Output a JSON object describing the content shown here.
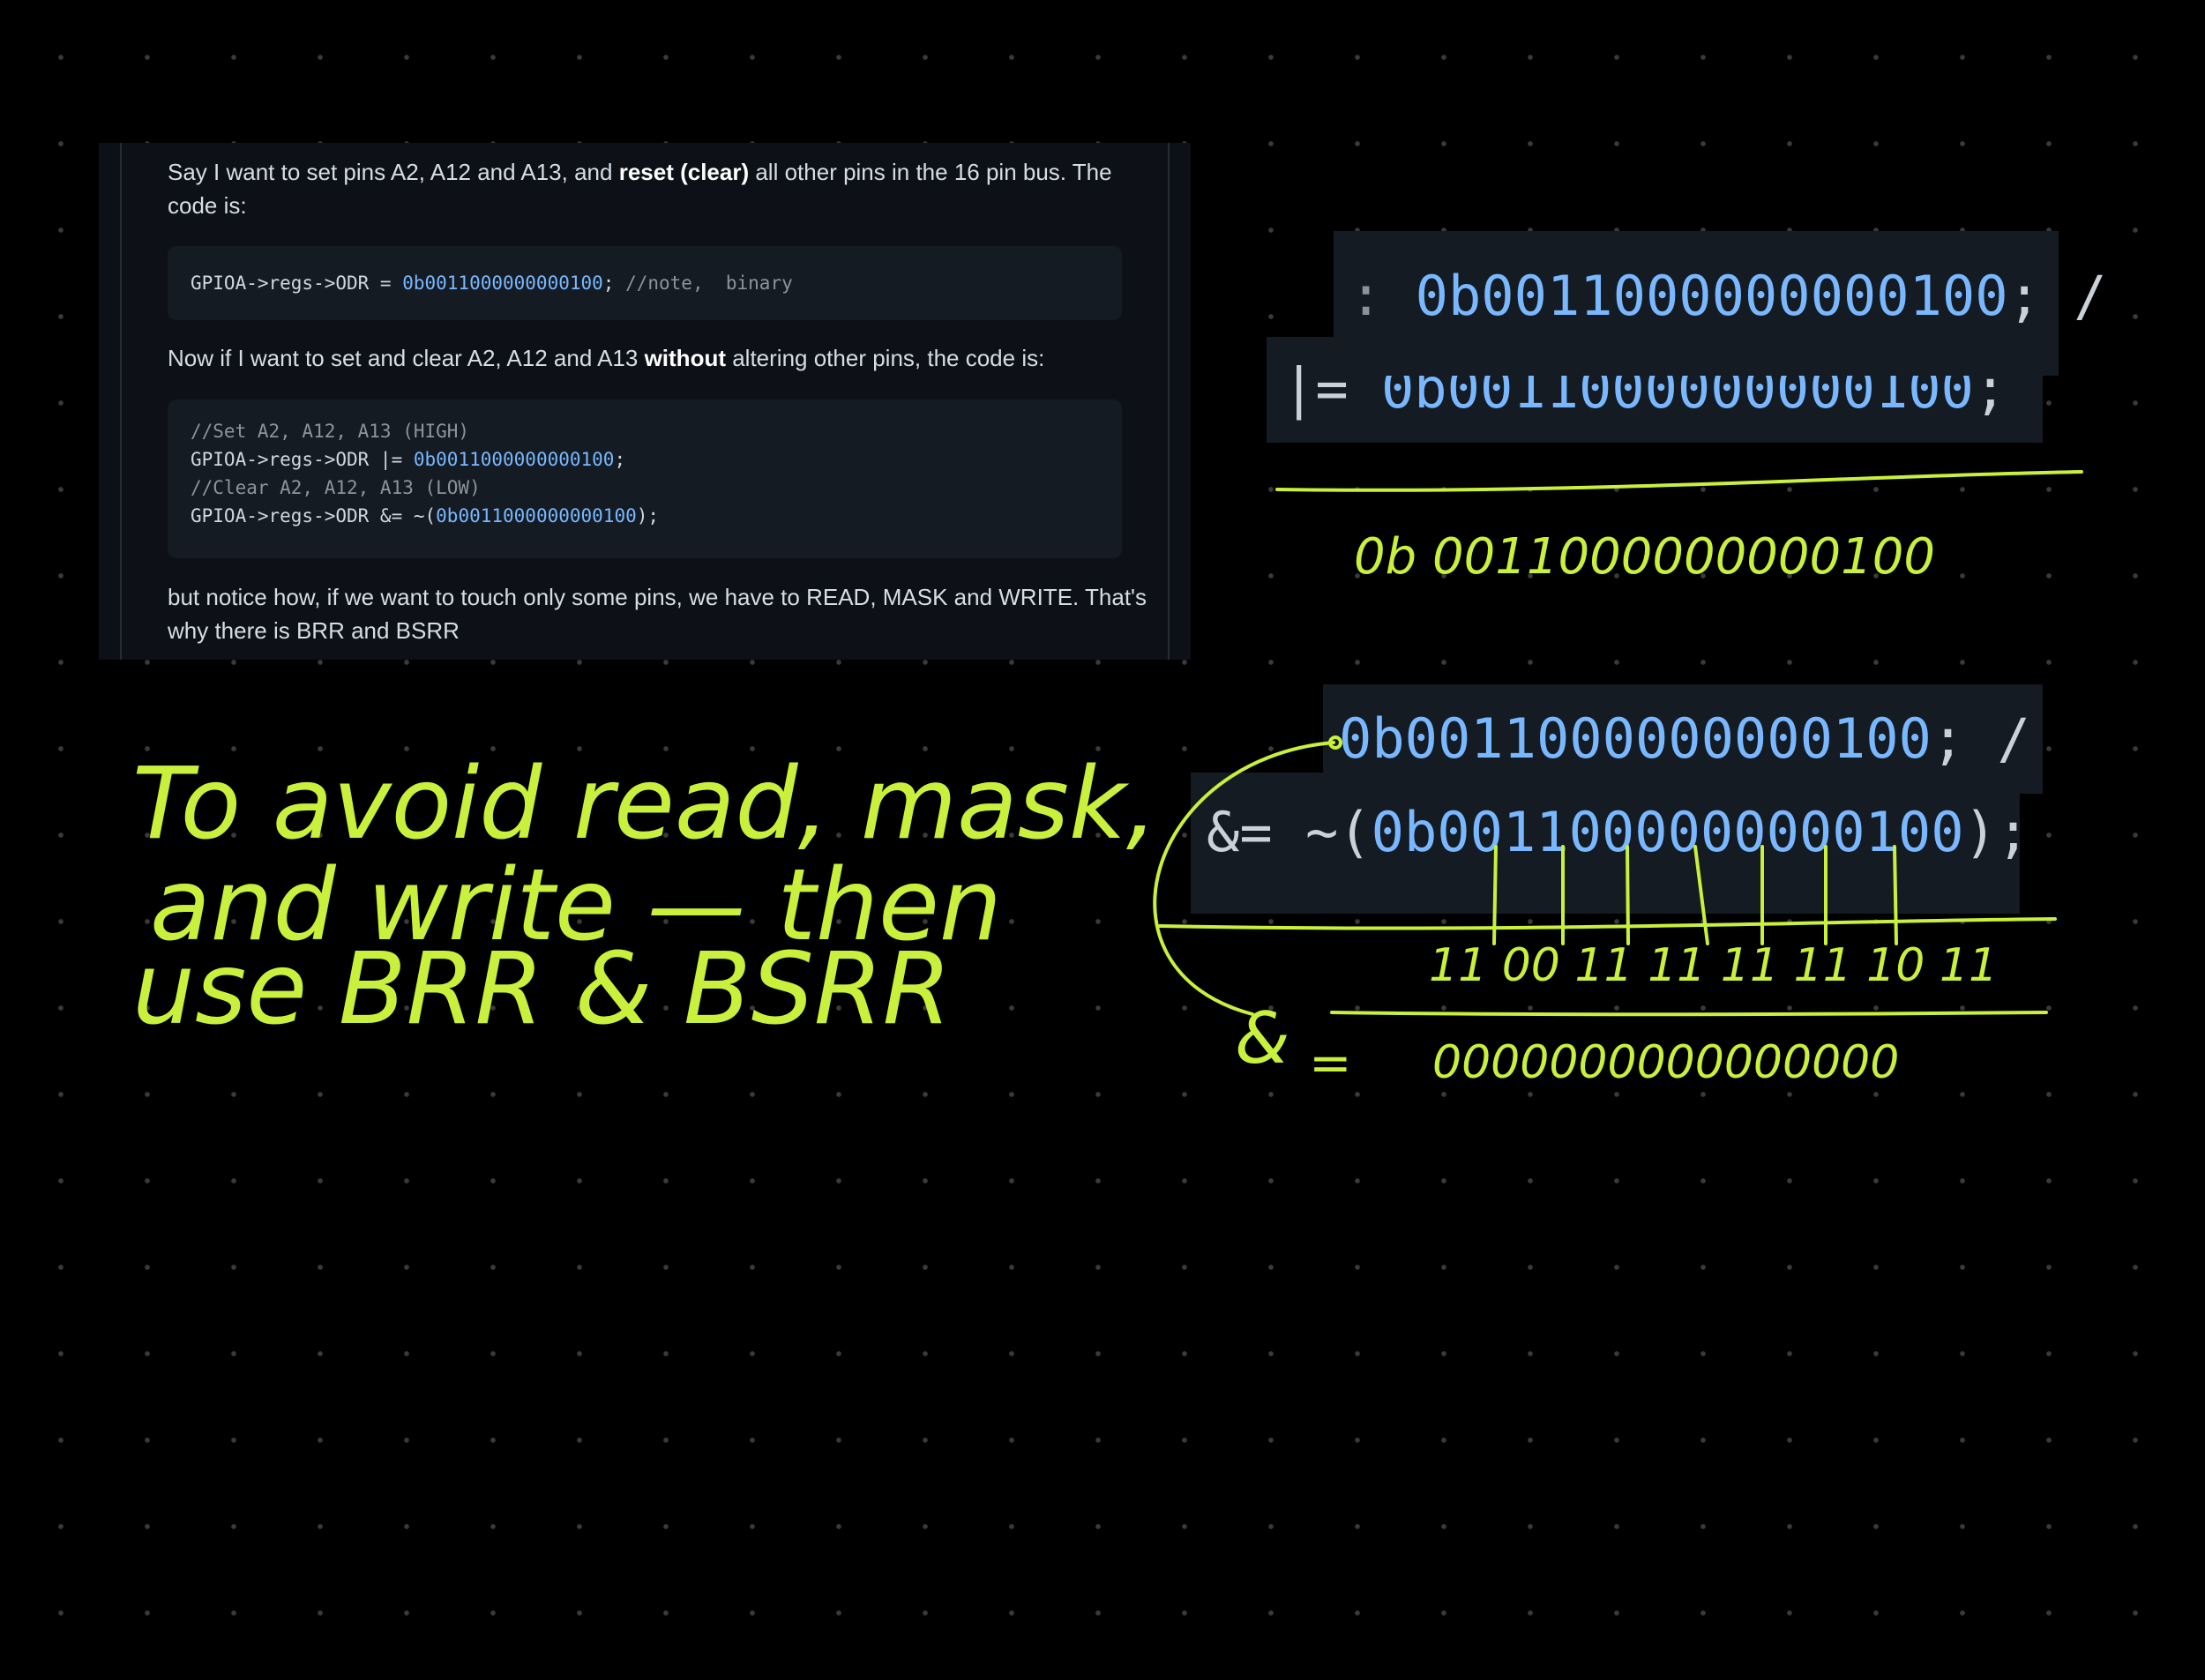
{
  "panel": {
    "para1_a": "Say I want to set pins A2, A12 and A13, and ",
    "para1_bold": "reset (clear)",
    "para1_b": " all other pins in the 16 pin bus. The code is:",
    "code1": {
      "prefix": "GPIOA->regs->ODR = ",
      "value": "0b0011000000000100",
      "suffix": "; ",
      "comment": "//note,  binary"
    },
    "para2_a": "Now if I want to set and clear A2, A12 and A13 ",
    "para2_bold": "without",
    "para2_b": " altering other pins, the code is:",
    "code2": {
      "line1": "//Set A2, A12, A13 (HIGH)",
      "line2_prefix": "GPIOA->regs->ODR |= ",
      "line2_value": "0b0011000000000100",
      "line2_suffix": ";",
      "line3": "//Clear A2, A12, A13 (LOW)",
      "line4_prefix": "GPIOA->regs->ODR &= ~(",
      "line4_value": "0b0011000000000100",
      "line4_suffix": ");"
    },
    "para3": "but notice how, if we want to touch only some pins, we have to READ, MASK and WRITE. That's why there is BRR and BSRR"
  },
  "zoom1": {
    "line1_prefix": ": ",
    "line1_value": "0b0011000000000100",
    "line1_suffix": "; /",
    "line2_prefix": "|= ",
    "line2_value": "0b0011000000000100",
    "line2_suffix": ";"
  },
  "zoom2": {
    "line1_value": "0b0011000000000100",
    "line1_suffix": "; /",
    "line2_prefix": "&= ~(",
    "line2_value": "0b0011000000000100",
    "line2_suffix": ");"
  },
  "handwriting": {
    "note_line1": "To avoid read, mask,",
    "note_line2": "and write — then",
    "note_line3": "use BRR & BSRR",
    "result_or": "0b 0011000000000100",
    "inverted": "11 00 11 11 11 11 10 11",
    "amp": "&",
    "eq": "=",
    "result_and": "0000000000000000"
  },
  "colors": {
    "ink": "#c8f03c",
    "number": "#79b8ff",
    "background": "#000000"
  }
}
